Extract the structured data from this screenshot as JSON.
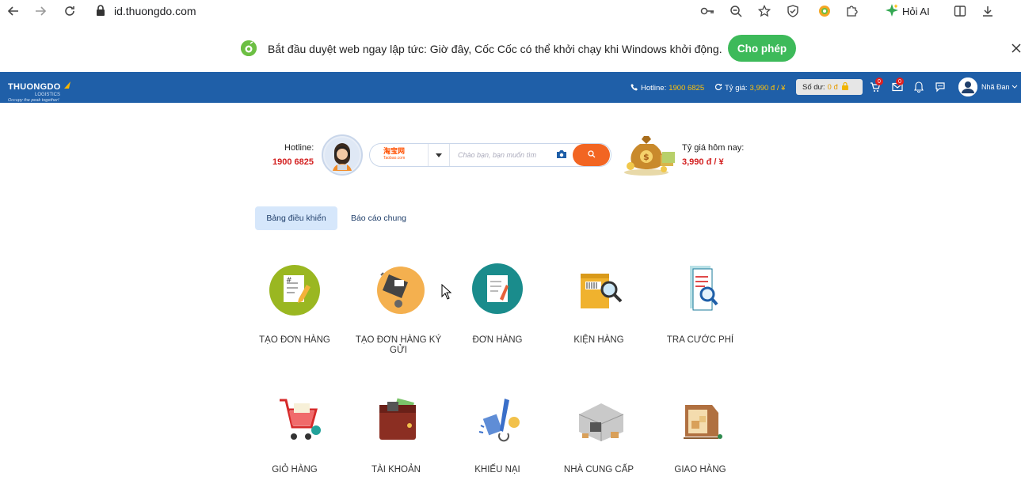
{
  "browser": {
    "url": "id.thuongdo.com",
    "ask_ai": "Hỏi AI"
  },
  "infobar": {
    "message": "Bắt đầu duyệt web ngay lập tức: Giờ đây, Cốc Cốc có thể khởi chạy khi Windows khởi động.",
    "allow_label": "Cho phép"
  },
  "site_header": {
    "brand_name": "THUONGDO",
    "brand_sub": "LOGISTICS",
    "brand_tagline": "Occupy the peak together!",
    "hotline_label": "Hotline:",
    "hotline_value": "1900 6825",
    "rate_label": "Tỷ giá:",
    "rate_value": "3,990 đ / ¥",
    "balance_label": "Số dư:",
    "balance_value": "0 đ",
    "cart_count": "0",
    "mail_count": "0",
    "user_name": "Nhã Đan"
  },
  "search": {
    "hotline_label": "Hotline:",
    "hotline_value": "1900 6825",
    "source_label": "淘宝网",
    "source_sub": "Taobao.com",
    "placeholder": "Chào bạn, bạn muốn tìm",
    "rate_label": "Tỷ giá hôm nay:",
    "rate_value": "3,990 đ / ¥"
  },
  "tabs": [
    {
      "label": "Bảng điều khiển",
      "active": true
    },
    {
      "label": "Báo cáo chung",
      "active": false
    }
  ],
  "tiles": [
    {
      "label": "TẠO ĐƠN HÀNG",
      "icon": "create-order-icon"
    },
    {
      "label": "TẠO ĐƠN HÀNG KÝ GỬI",
      "icon": "consignment-order-icon"
    },
    {
      "label": "ĐƠN HÀNG",
      "icon": "orders-icon"
    },
    {
      "label": "KIỆN HÀNG",
      "icon": "packages-icon"
    },
    {
      "label": "TRA CƯỚC PHÍ",
      "icon": "fee-lookup-icon"
    },
    {
      "label": "GIỎ HÀNG",
      "icon": "cart-icon"
    },
    {
      "label": "TÀI KHOẢN",
      "icon": "wallet-icon"
    },
    {
      "label": "KHIẾU NẠI",
      "icon": "complaint-icon"
    },
    {
      "label": "NHÀ CUNG CẤP",
      "icon": "supplier-icon"
    },
    {
      "label": "GIAO HÀNG",
      "icon": "delivery-icon"
    }
  ],
  "colors": {
    "header_bg": "#1f5fa8",
    "accent_orange": "#f26522",
    "price_red": "#d32020",
    "allow_green": "#3dba5a"
  }
}
